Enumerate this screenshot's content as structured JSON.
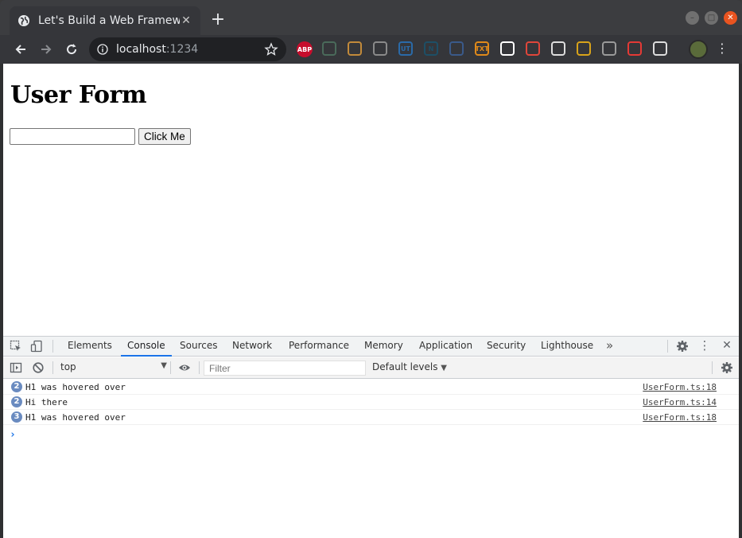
{
  "browser": {
    "tab_title": "Let's Build a Web Framew",
    "tab_icon": "globe-icon",
    "new_tab_label": "+",
    "url_host": "localhost",
    "url_port": ":1234",
    "extensions": [
      {
        "name": "adblock-plus-icon",
        "label": "ABP",
        "color": "#c70d2c"
      },
      {
        "name": "graph-extension-icon",
        "label": "",
        "color": "#4a6a5a"
      },
      {
        "name": "cookie-extension-icon",
        "label": "",
        "color": "#c28a3a"
      },
      {
        "name": "cloud-extension-icon",
        "label": "",
        "color": "#8a8a8a"
      },
      {
        "name": "ut-extension-icon",
        "label": "UT",
        "color": "#2a6aa8"
      },
      {
        "name": "n-extension-icon",
        "label": "N",
        "color": "#1d4f66"
      },
      {
        "name": "screenshot-extension-icon",
        "label": "",
        "color": "#3a5a8a"
      },
      {
        "name": "txt-extension-icon",
        "label": "TXT",
        "color": "#e08a1a"
      },
      {
        "name": "github-icon",
        "label": "",
        "color": "#ffffff"
      },
      {
        "name": "image-extension-icon",
        "label": "",
        "color": "#e0463a"
      },
      {
        "name": "hand-extension-icon",
        "label": "",
        "color": "#dddddd"
      },
      {
        "name": "books-extension-icon",
        "label": "",
        "color": "#d8a31a"
      },
      {
        "name": "bug-extension-icon",
        "label": "",
        "color": "#9a9a9a"
      },
      {
        "name": "asterisk-extension-icon",
        "label": "",
        "color": "#e53935"
      },
      {
        "name": "react-devtools-icon",
        "label": "",
        "color": "#dddddd"
      }
    ]
  },
  "page": {
    "heading": "User Form",
    "button_label": "Click Me",
    "input_value": ""
  },
  "devtools": {
    "tabs": [
      "Elements",
      "Console",
      "Sources",
      "Network",
      "Performance",
      "Memory",
      "Application",
      "Security",
      "Lighthouse"
    ],
    "active_tab": "Console",
    "context": "top",
    "filter_placeholder": "Filter",
    "levels_label": "Default levels",
    "messages": [
      {
        "count": "2",
        "text": "H1 was hovered over",
        "source": "UserForm.ts:18"
      },
      {
        "count": "2",
        "text": "Hi there",
        "source": "UserForm.ts:14"
      },
      {
        "count": "3",
        "text": "H1 was hovered over",
        "source": "UserForm.ts:18"
      }
    ],
    "prompt_symbol": "›"
  }
}
